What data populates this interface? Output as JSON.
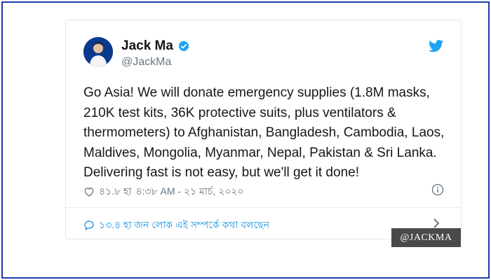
{
  "tweet": {
    "author_name": "Jack Ma",
    "handle": "@JackMa",
    "text": "Go Asia! We will donate emergency supplies (1.8M masks, 210K test kits, 36K protective suits, plus ventilators & thermometers) to Afghanistan, Bangladesh, Cambodia, Laos, Maldives, Mongolia, Myanmar, Nepal, Pakistan & Sri Lanka. Delivering fast is not easy, but we'll get it done!",
    "likes": "৪১.৮ হা",
    "timestamp": "৪:৩৮ AM - ২১ মার্চ, ২০২০",
    "talking_count": "১৩.৪ হা জন লোক এই সম্পর্কে কথা বলছেন"
  },
  "watermark": "@JACKMA",
  "icons": {
    "verified": "verified-badge-icon",
    "twitter": "twitter-bird-icon",
    "like": "heart-icon",
    "info": "info-icon",
    "reply": "speech-bubble-icon",
    "more": "chevron-right-icon"
  },
  "colors": {
    "frame_border": "#1c3aa9",
    "twitter_blue": "#1da1f2",
    "link_blue": "#1b95e0",
    "secondary_text": "#657786",
    "watermark_bg": "#4a4a4a"
  }
}
